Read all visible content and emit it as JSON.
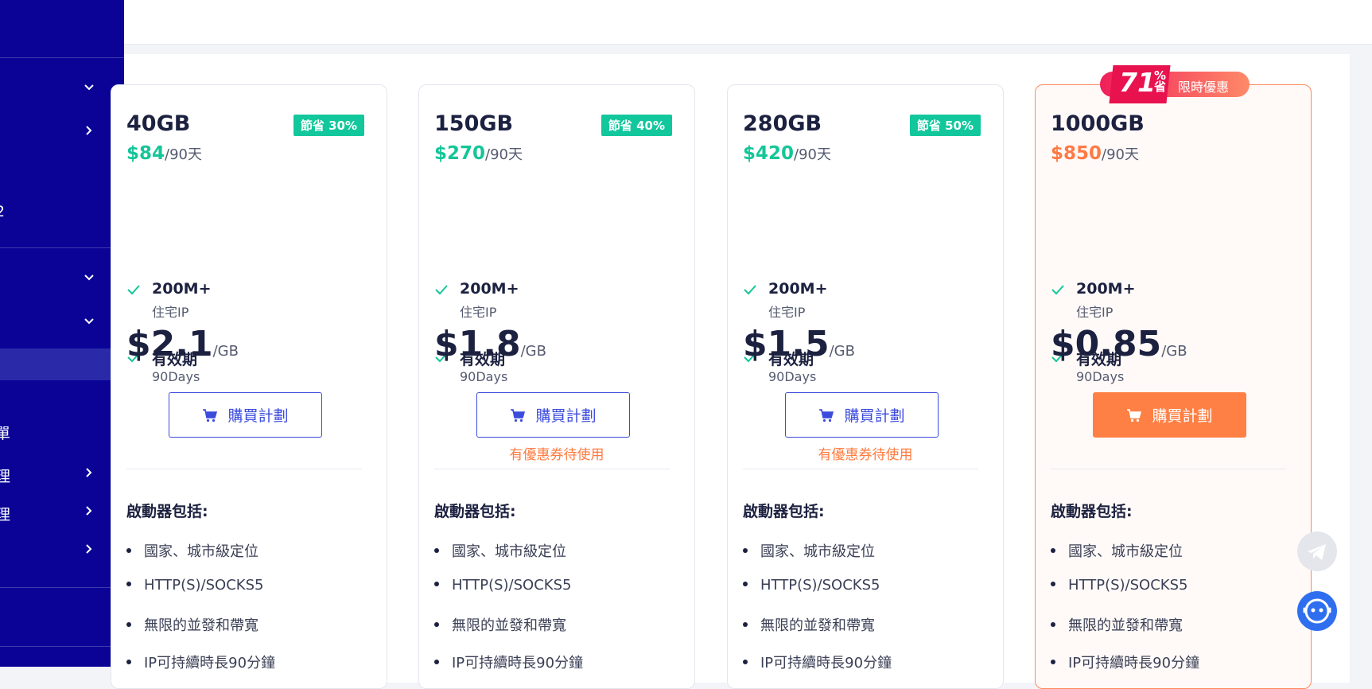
{
  "sidebar": {
    "items": [
      {
        "label": "",
        "chevron": "down"
      },
      {
        "label": "",
        "chevron": "right"
      },
      {
        "label": "2",
        "chevron": ""
      },
      {
        "label": "",
        "chevron": "down"
      },
      {
        "label": "",
        "chevron": "down"
      },
      {
        "label": "",
        "chevron": "",
        "active": true
      },
      {
        "label": "單",
        "chevron": ""
      },
      {
        "label": "理",
        "chevron": "right"
      },
      {
        "label": "理",
        "chevron": "right"
      },
      {
        "label": "",
        "chevron": "right"
      }
    ]
  },
  "promo": {
    "number": "71",
    "percent": "%",
    "save": "省",
    "text": "限時優惠"
  },
  "plans": [
    {
      "gb": "40GB",
      "save": "節省 30%",
      "price": "$84",
      "period": "/90天",
      "feat1_title": "200M+",
      "feat1_sub": "住宅IP",
      "feat2_title": "有效期",
      "feat2_sub": "90Days",
      "per_gb": "$2.1",
      "unit": "/GB",
      "buy": "購買計劃",
      "coupon": "",
      "inc_title": "啟動器包括:",
      "bullets": [
        "國家、城市級定位",
        "HTTP(S)/SOCKS5",
        "無限的並發和帶寬",
        "IP可持續時長90分鐘"
      ]
    },
    {
      "gb": "150GB",
      "save": "節省 40%",
      "price": "$270",
      "period": "/90天",
      "feat1_title": "200M+",
      "feat1_sub": "住宅IP",
      "feat2_title": "有效期",
      "feat2_sub": "90Days",
      "per_gb": "$1.8",
      "unit": "/GB",
      "buy": "購買計劃",
      "coupon": "有優惠券待使用",
      "inc_title": "啟動器包括:",
      "bullets": [
        "國家、城市級定位",
        "HTTP(S)/SOCKS5",
        "無限的並發和帶寬",
        "IP可持續時長90分鐘"
      ]
    },
    {
      "gb": "280GB",
      "save": "節省 50%",
      "price": "$420",
      "period": "/90天",
      "feat1_title": "200M+",
      "feat1_sub": "住宅IP",
      "feat2_title": "有效期",
      "feat2_sub": "90Days",
      "per_gb": "$1.5",
      "unit": "/GB",
      "buy": "購買計劃",
      "coupon": "有優惠券待使用",
      "inc_title": "啟動器包括:",
      "bullets": [
        "國家、城市級定位",
        "HTTP(S)/SOCKS5",
        "無限的並發和帶寬",
        "IP可持續時長90分鐘"
      ]
    },
    {
      "gb": "1000GB",
      "save": "",
      "price": "$850",
      "period": "/90天",
      "feat1_title": "200M+",
      "feat1_sub": "住宅IP",
      "feat2_title": "有效期",
      "feat2_sub": "90Days",
      "per_gb": "$0.85",
      "unit": "/GB",
      "buy": "購買計劃",
      "coupon": "",
      "inc_title": "啟動器包括:",
      "bullets": [
        "國家、城市級定位",
        "HTTP(S)/SOCKS5",
        "無限的並發和帶寬",
        "IP可持續時長90分鐘"
      ]
    }
  ],
  "floating": [
    {
      "icon": "telegram-icon"
    },
    {
      "icon": "support-chat-icon"
    }
  ],
  "colors": {
    "sidebar": "#0a0396",
    "accent_green": "#14c698",
    "accent_orange": "#ff7a44",
    "button_blue": "#3b4bdc",
    "promo_pink": "#e8124f"
  }
}
